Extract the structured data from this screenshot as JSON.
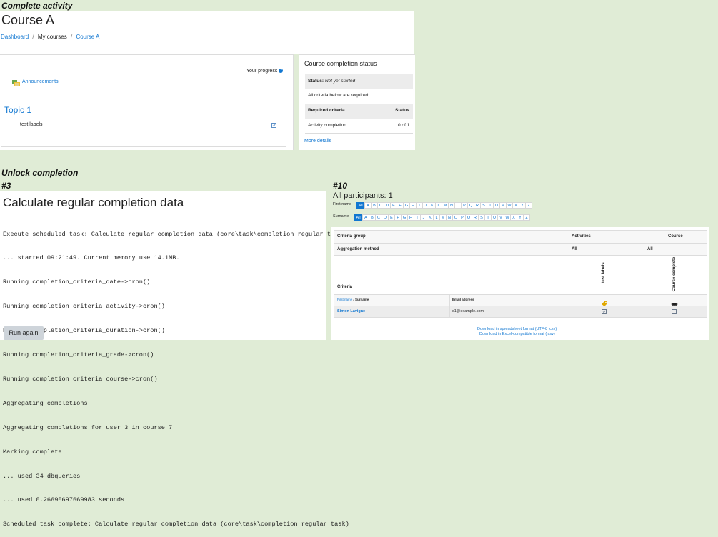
{
  "sections": {
    "complete_activity": "Complete activity",
    "unlock_completion": "Unlock completion",
    "step3": "#3",
    "step10": "#10"
  },
  "course": {
    "title": "Course A",
    "breadcrumb": [
      "Dashboard",
      "My courses",
      "Course A"
    ],
    "your_progress": "Your progress",
    "announcements": "Announcements",
    "topic_title": "Topic 1",
    "activity_label": "test labels"
  },
  "completion_status": {
    "title": "Course completion status",
    "status_label": "Status:",
    "status_value": "Not yet started",
    "all_required": "All criteria below are required:",
    "col_required": "Required criteria",
    "col_status": "Status",
    "row_name": "Activity completion",
    "row_value": "0 of 1",
    "more_details": "More details"
  },
  "task": {
    "title": "Calculate regular completion data",
    "output": [
      "Execute scheduled task: Calculate regular completion data (core\\task\\completion_regular_task)",
      "... started 09:21:49. Current memory use 14.1MB.",
      "Running completion_criteria_date->cron()",
      "Running completion_criteria_activity->cron()",
      "Running completion_criteria_duration->cron()",
      "Running completion_criteria_grade->cron()",
      "Running completion_criteria_course->cron()",
      "Aggregating completions",
      "Aggregating completions for user 3 in course 7",
      "Marking complete",
      "... used 34 dbqueries",
      "... used 0.26690697669983 seconds",
      "Scheduled task complete: Calculate regular completion data (core\\task\\completion_regular_task)"
    ],
    "run_again": "Run again"
  },
  "participants": {
    "title": "All participants: 1",
    "firstname_label": "First name",
    "surname_label": "Surname",
    "letters": [
      "All",
      "A",
      "B",
      "C",
      "D",
      "E",
      "F",
      "G",
      "H",
      "I",
      "J",
      "K",
      "L",
      "M",
      "N",
      "O",
      "P",
      "Q",
      "R",
      "S",
      "T",
      "U",
      "V",
      "W",
      "X",
      "Y",
      "Z"
    ],
    "table": {
      "criteria_group": "Criteria group",
      "activities": "Activities",
      "course": "Course",
      "aggregation_method": "Aggregation method",
      "agg_activities": "All",
      "agg_course": "All",
      "criteria": "Criteria",
      "col_activity_rot": "test labels",
      "col_course_rot": "Course complete",
      "first_name": "First name",
      "surname": "Surname",
      "name_sep": " / ",
      "email_header": "Email address",
      "user_name": "Simon Lavigne",
      "user_email": "s1@example.com"
    },
    "download_csv": "Download in spreadsheet format (UTF-8 .csv)",
    "download_excel": "Download in Excel-compatible format (.csv)"
  }
}
